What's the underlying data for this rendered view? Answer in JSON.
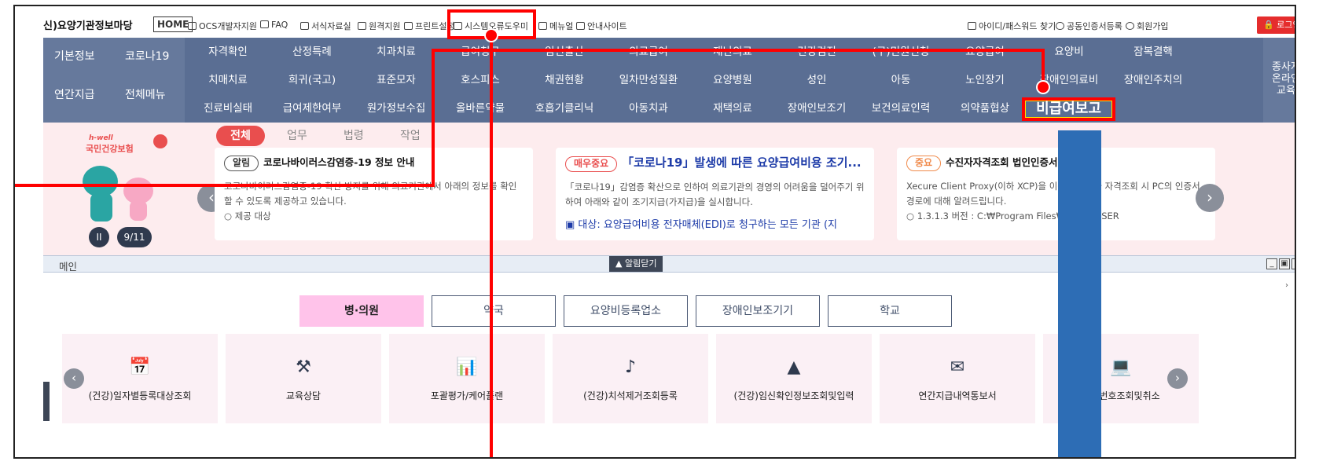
{
  "topbar": {
    "brand": "신)요양기관정보마당",
    "home": "HOME",
    "links": [
      "OCS개발자지원",
      "FAQ",
      "서식자료실",
      "원격지원",
      "프린트설정",
      "시스템오류도우미",
      "메뉴얼",
      "안내사이트"
    ],
    "right_links": [
      "아이디/패스워드 찾기",
      "공동인증서등록",
      "회원가입"
    ],
    "login": "로그인"
  },
  "nav": {
    "left": [
      "기본정보",
      "코로나19",
      "연간지급",
      "전체메뉴"
    ],
    "row1": [
      "자격확인",
      "산정특례",
      "치과치료",
      "급여청구",
      "임신출산",
      "의료급여",
      "재난의료",
      "건강검진",
      "(구)민원신청",
      "요양급여",
      "요양비",
      "잠복결핵"
    ],
    "row2": [
      "치매치료",
      "희귀(국고)",
      "표준모자",
      "호스피스",
      "채권현황",
      "일차만성질환",
      "요양병원",
      "성인",
      "아동",
      "노인장기",
      "장애인의료비",
      "장애인주치의"
    ],
    "row3": [
      "진료비실태",
      "급여제한여부",
      "원가정보수집",
      "올바른약물",
      "호흡기클리닉",
      "아동치과",
      "재택의료",
      "장애인보조기",
      "보건의료인력",
      "의약품협상",
      "비급여보고"
    ],
    "right": "종사자\n온라인\n교육",
    "highlighted": "비급여보고"
  },
  "banner": {
    "logo_small": "h-well",
    "logo": "국민건강보험",
    "page_indicator": "9/11",
    "tabs": [
      "전체",
      "업무",
      "법령",
      "작업"
    ],
    "cards": [
      {
        "badge": "알림",
        "title": "코로나바이러스감염증-19 정보 안내",
        "body": "코로나바이러스감염증-19 확산 방지를 위해 의료기관에서 아래의 정보를 확인할 수 있도록 제공하고 있습니다.",
        "extra": "○ 제공 대상"
      },
      {
        "badge": "매우중요",
        "title": "「코로나19」발생에 따른 요양급여비용 조기...",
        "body": "「코로나19」감염증 확산으로 인하여 의료기관의 경영의 어려움을 덜어주기 위하여 아래와 같이 조기지급(가지급)을 실시합니다.",
        "extra": "▣ 대상: 요양급여비용 전자매체(EDI)로 청구하는 모든 기관 (지"
      },
      {
        "badge": "중요",
        "title": "수진자자격조회 법인인증서 경로 안내",
        "body": "Xecure Client Proxy(이하 XCP)을 이용한 수진자 자격조회 시 PC의 인증서 경로에 대해 알려드립니다.",
        "extra": "○ 1.3.1.3 버전 : C:₩Program Files₩NPKI₩USER"
      }
    ]
  },
  "main": {
    "title": "메인",
    "alert_close": "▲ 알림닫기",
    "categories": [
      "병·의원",
      "약국",
      "요양비등록업소",
      "장애인보조기기",
      "학교"
    ],
    "tiles": [
      {
        "label": "(건강)일자별등록대상조회",
        "icon": "calendar-search-icon"
      },
      {
        "label": "교육상담",
        "icon": "headset-icon"
      },
      {
        "label": "포괄평가/케어플랜",
        "icon": "presentation-chart-icon"
      },
      {
        "label": "(건강)치석제거조회등록",
        "icon": "tooth-icon"
      },
      {
        "label": "(건강)임신확인정보조회및입력",
        "icon": "pregnant-icon"
      },
      {
        "label": "연간지급내역통보서",
        "icon": "mail-icon"
      },
      {
        "label": "확인번호조회및취소",
        "icon": "monitor-search-icon"
      }
    ]
  },
  "colors": {
    "nav": "#5a6e93",
    "highlight": "#ff0000",
    "accent": "#e94e4e",
    "active_category": "#ffc3ea"
  }
}
